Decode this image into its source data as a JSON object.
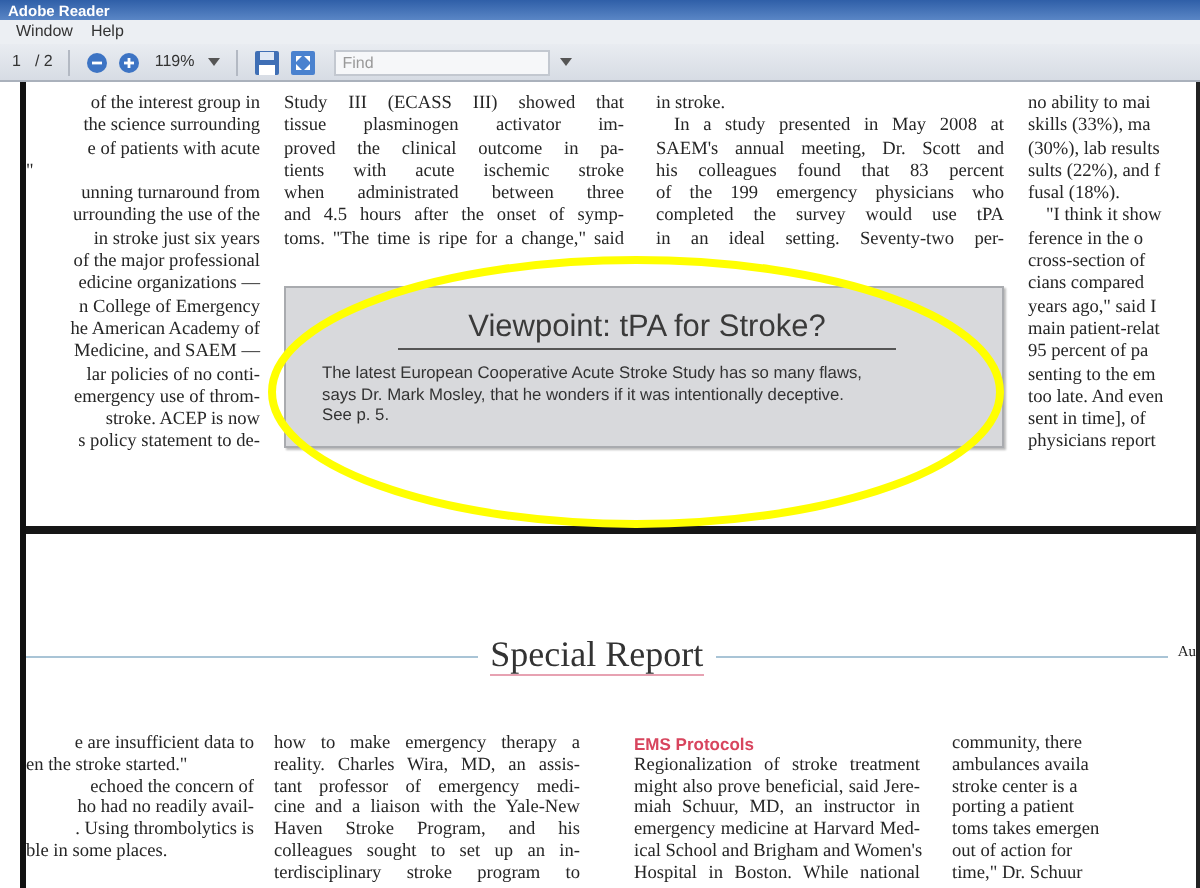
{
  "window": {
    "title": "Adobe Reader"
  },
  "menu": [
    "Window",
    "Help"
  ],
  "toolbar": {
    "page": "1",
    "page_count": "/ 2",
    "zoom": "119%",
    "find": {
      "placeholder": "Find"
    }
  },
  "page_1": {
    "columns": [
      {
        "kind": "cut-left",
        "paragraphs": [
          {
            "ends": true,
            "lines": [
              "of the interest group in",
              "the science surrounding",
              "e of patients with acute",
              "\""
            ]
          },
          {
            "ends": false,
            "lines": [
              "unning turnaround from",
              "urrounding the use of the",
              "in stroke just six years",
              "of the major professional",
              "edicine organizations —",
              "n College of Emergency",
              "he American Academy of",
              "Medicine, and SAEM —",
              "lar policies of no conti-",
              "emergency use of throm-",
              "stroke. ACEP is now",
              "s policy statement to de-"
            ]
          }
        ]
      },
      {
        "kind": "full",
        "paragraphs": [
          {
            "indent": false,
            "ends": false,
            "lines": [
              "Study III (ECASS III) showed that",
              "tissue plasminogen activator im-",
              "proved the clinical outcome in pa-",
              "tients with acute ischemic stroke",
              "when administrated between three",
              "and 4.5 hours after the onset of symp-",
              "toms. \"The time is ripe for a change,\" said"
            ]
          }
        ]
      },
      {
        "kind": "full",
        "paragraphs": [
          {
            "indent": false,
            "ends": true,
            "lines": [
              "in stroke."
            ]
          },
          {
            "indent": true,
            "ends": false,
            "lines": [
              "In a study presented in May 2008 at",
              "SAEM's annual meeting, Dr. Scott and",
              "his colleagues found that 83 percent",
              "of the 199 emergency physicians who",
              "completed the survey would use tPA",
              "in an ideal setting. Seventy-two per-"
            ]
          }
        ]
      },
      {
        "kind": "cut-right",
        "paragraphs": [
          {
            "indent": false,
            "lines": [
              "no ability to mai",
              "skills (33%), ma",
              "(30%), lab results",
              "sults (22%), and f",
              "fusal (18%)."
            ]
          },
          {
            "indent": true,
            "lines": [
              "\"I think it show",
              "ference in the o",
              "cross-section of",
              "cians compared",
              "years ago,\" said I",
              "main patient-relat",
              "95 percent of pa",
              "senting to the em",
              "too late. And even",
              "sent in time], of",
              "physicians report"
            ]
          }
        ]
      }
    ],
    "viewpoint": {
      "title": "Viewpoint: tPA for Stroke?",
      "text_lines": [
        "The latest European Cooperative Acute Stroke Study has so many flaws,",
        "says Dr. Mark Mosley, that he wonders if it was intentionally deceptive.",
        "See p. 5."
      ]
    }
  },
  "page_2": {
    "section_title": "Special Report",
    "corner_text": "Au",
    "columns": [
      {
        "kind": "cut-left",
        "paragraphs": [
          {
            "ends": true,
            "lines": [
              "e are insufficient data to",
              "en the stroke started.\""
            ]
          },
          {
            "ends": true,
            "lines": [
              "echoed the concern of",
              "ho had no readily avail-",
              ". Using thrombolytics is",
              "ble in some places."
            ]
          }
        ]
      },
      {
        "kind": "full",
        "paragraphs": [
          {
            "indent": false,
            "ends": false,
            "lines": [
              "how to make emergency therapy a",
              "reality. Charles Wira, MD, an assis-",
              "tant professor of emergency medi-",
              "cine and a liaison with the Yale-New",
              "Haven Stroke Program, and his",
              "colleagues sought to set up an in-",
              "terdisciplinary stroke program to"
            ]
          }
        ]
      },
      {
        "kind": "full",
        "heading": "EMS Protocols",
        "paragraphs": [
          {
            "indent": false,
            "ends": false,
            "lines": [
              "Regionalization of stroke treatment",
              "might also prove beneficial, said Jere-",
              "miah Schuur, MD, an instructor in",
              "emergency medicine at Harvard Med-",
              "ical School and Brigham and Women's",
              "Hospital in Boston. While national"
            ]
          }
        ]
      },
      {
        "kind": "cut-right",
        "paragraphs": [
          {
            "indent": false,
            "lines": [
              "community, there",
              "ambulances availa",
              "stroke center is a",
              "porting a patient",
              "toms takes emergen",
              "out of action for",
              "time,\" Dr. Schuur"
            ]
          }
        ]
      }
    ]
  }
}
